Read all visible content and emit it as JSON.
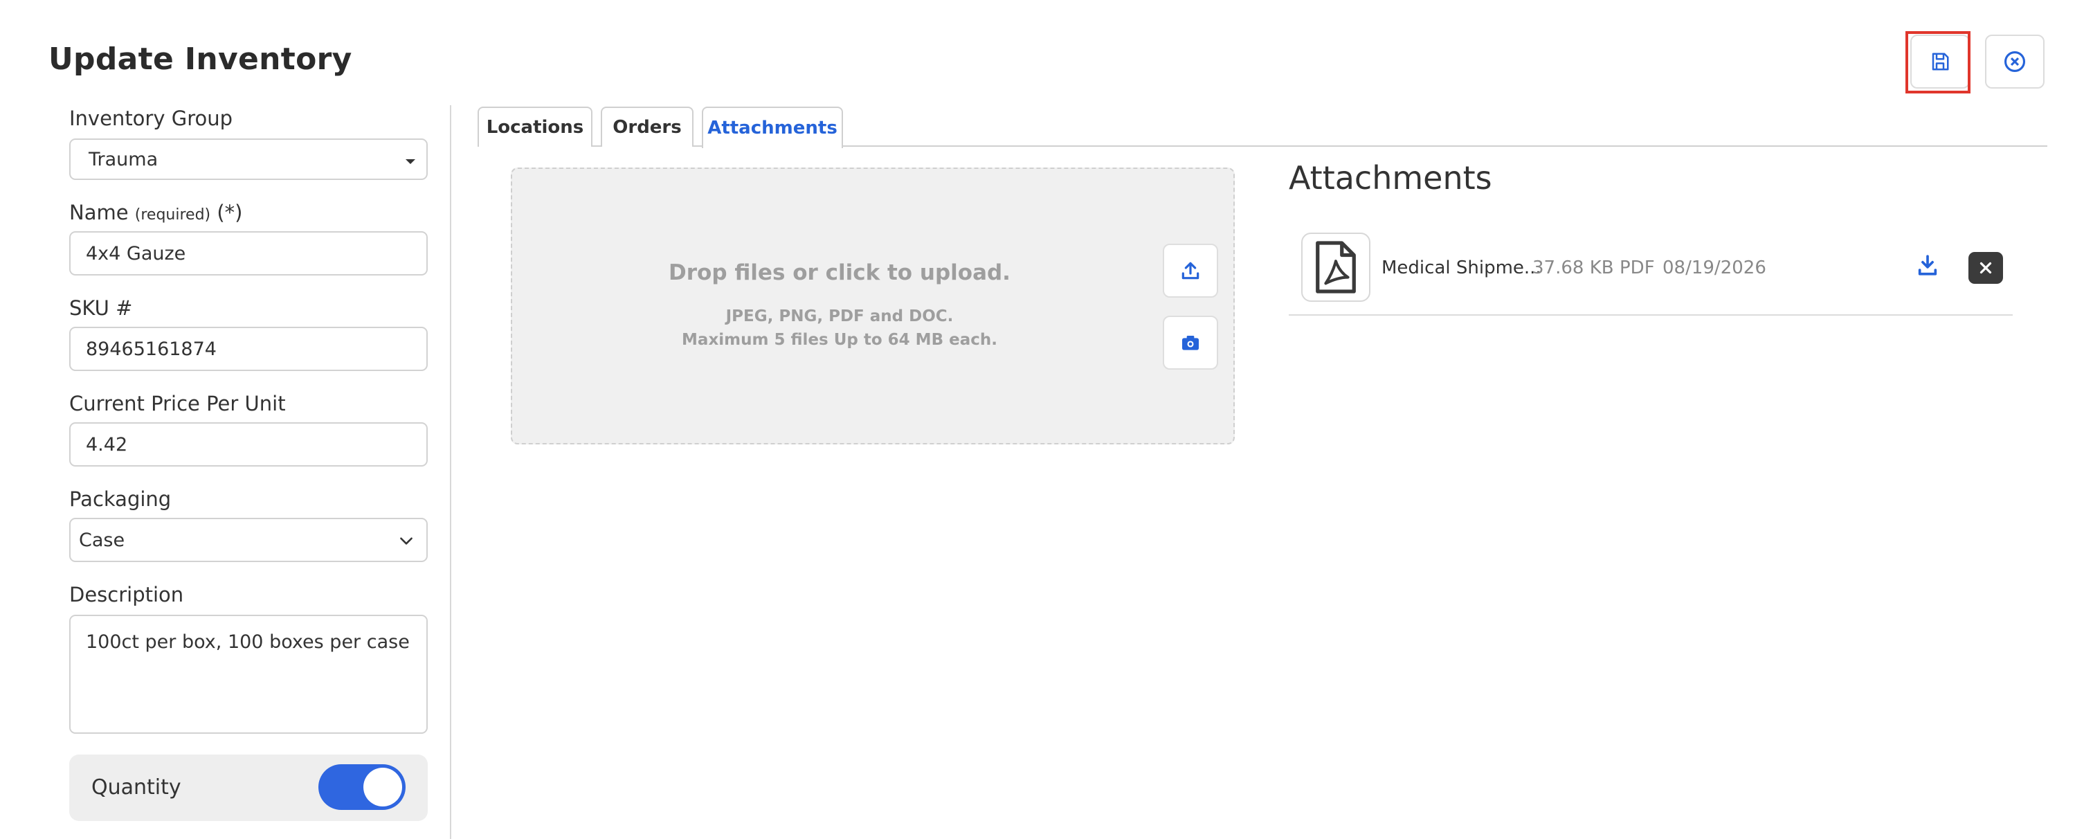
{
  "page": {
    "title": "Update Inventory"
  },
  "header": {
    "save_icon": "save-icon",
    "close_icon": "close-circle-icon",
    "accent_color": "#2563d9",
    "highlight_color": "#e0362c"
  },
  "form": {
    "inventory_group": {
      "label": "Inventory Group",
      "value": "Trauma"
    },
    "name": {
      "label": "Name",
      "required_note": "(required)",
      "required_mark": "(*)",
      "value": "4x4 Gauze"
    },
    "sku": {
      "label": "SKU #",
      "value": "89465161874"
    },
    "price": {
      "label": "Current Price Per Unit",
      "value": "4.42"
    },
    "packaging": {
      "label": "Packaging",
      "value": "Case"
    },
    "description": {
      "label": "Description",
      "value": "100ct per box, 100 boxes per case"
    },
    "quantity": {
      "label": "Quantity",
      "enabled": true
    }
  },
  "tabs": [
    {
      "label": "Locations",
      "active": false
    },
    {
      "label": "Orders",
      "active": false
    },
    {
      "label": "Attachments",
      "active": true
    }
  ],
  "upload": {
    "title": "Drop files or click to upload.",
    "types": "JPEG, PNG, PDF and DOC.",
    "limits": "Maximum 5 files Up to 64 MB each.",
    "upload_icon": "upload-icon",
    "camera_icon": "camera-icon"
  },
  "attachments": {
    "title": "Attachments",
    "items": [
      {
        "name": "Medical Shipme...",
        "size": "37.68 KB",
        "type": "PDF",
        "date": "08/19/2026",
        "icon": "pdf-file-icon"
      }
    ]
  }
}
